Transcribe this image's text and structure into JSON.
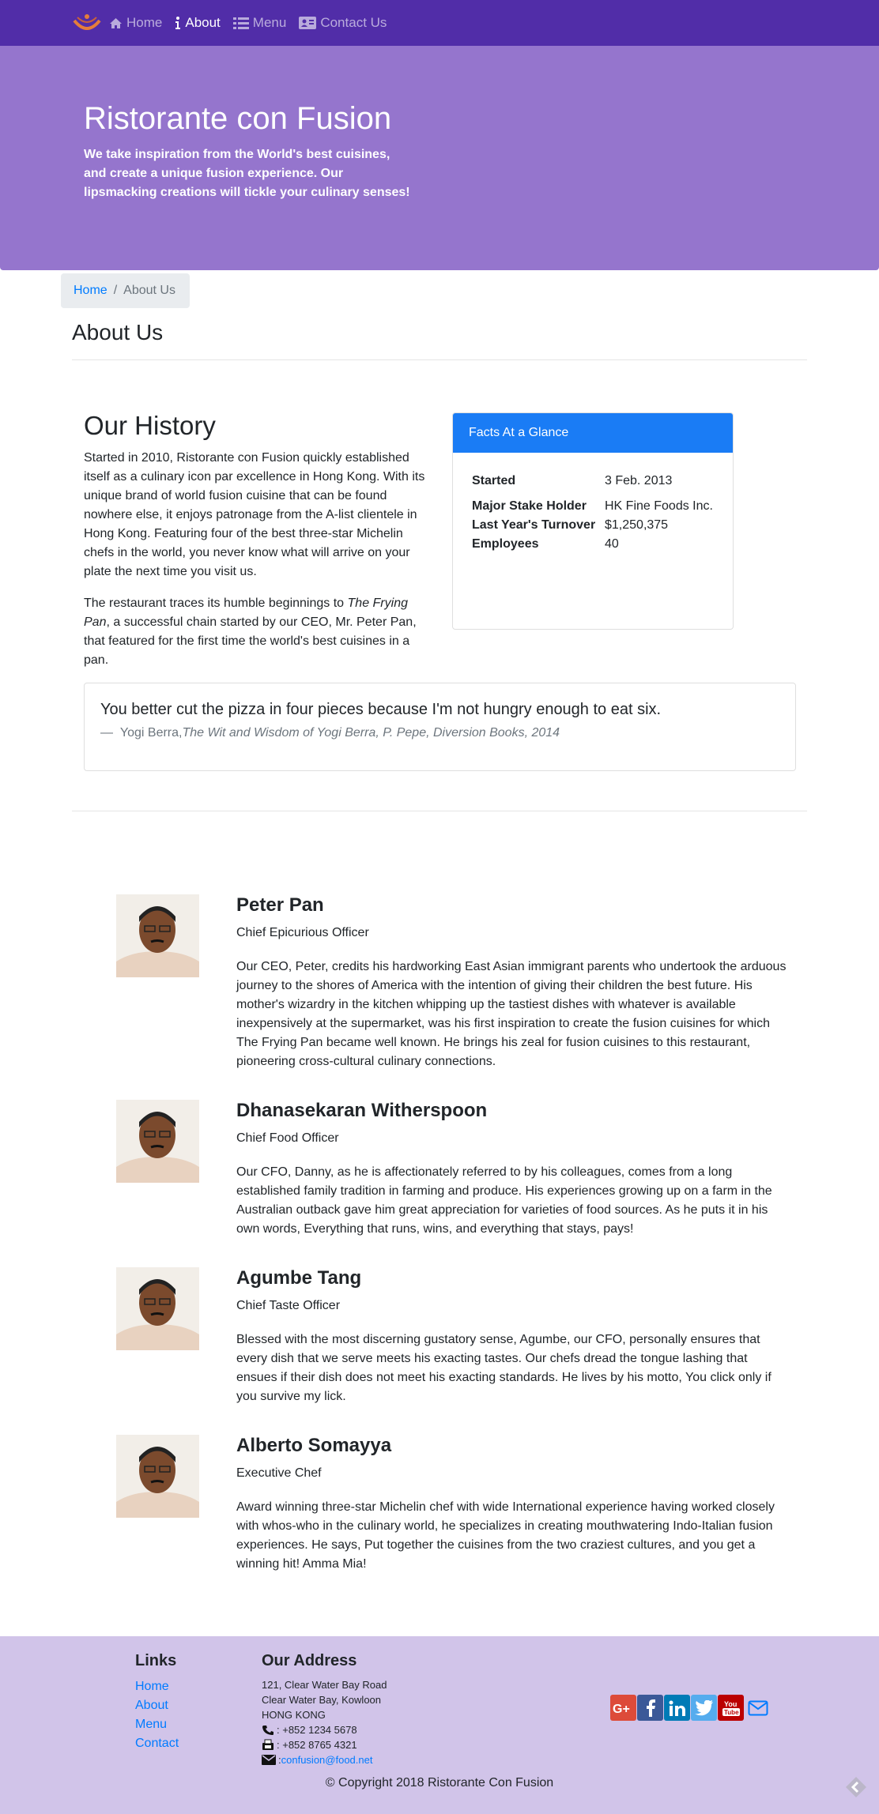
{
  "nav": {
    "items": [
      {
        "label": "Home",
        "icon": "home-icon"
      },
      {
        "label": "About",
        "icon": "info-icon"
      },
      {
        "label": "Menu",
        "icon": "list-icon"
      },
      {
        "label": "Contact Us",
        "icon": "address-card-icon"
      }
    ]
  },
  "jumbotron": {
    "title": "Ristorante con Fusion",
    "text": "We take inspiration from the World's best cuisines, and create a unique fusion experience. Our lipsmacking creations will tickle your culinary senses!"
  },
  "breadcrumb": {
    "home": "Home",
    "separator": "/",
    "current": "About Us"
  },
  "page_title": "About Us",
  "history": {
    "title": "Our History",
    "p1": "Started in 2010, Ristorante con Fusion quickly established itself as a culinary icon par excellence in Hong Kong. With its unique brand of world fusion cuisine that can be found nowhere else, it enjoys patronage from the A-list clientele in Hong Kong. Featuring four of the best three-star Michelin chefs in the world, you never know what will arrive on your plate the next time you visit us.",
    "p2_before": "The restaurant traces its humble beginnings to ",
    "p2_em": "The Frying Pan",
    "p2_after": ", a successful chain started by our CEO, Mr. Peter Pan, that featured for the first time the world's best cuisines in a pan."
  },
  "facts": {
    "header": "Facts At a Glance",
    "rows": [
      {
        "key": "Started",
        "value": "3 Feb. 2013"
      },
      {
        "key": "Major Stake Holder",
        "value": "HK Fine Foods Inc."
      },
      {
        "key": "Last Year's Turnover",
        "value": "$1,250,375"
      },
      {
        "key": "Employees",
        "value": "40"
      }
    ]
  },
  "quote": {
    "text": "You better cut the pizza in four pieces because I'm not hungry enough to eat six.",
    "dash": "—",
    "author": "Yogi Berra,",
    "source": "The Wit and Wisdom of Yogi Berra, P. Pepe, Diversion Books, 2014"
  },
  "leaders": [
    {
      "name": "Peter Pan",
      "role": "Chief Epicurious Officer",
      "desc": "Our CEO, Peter, credits his hardworking East Asian immigrant parents who undertook the arduous journey to the shores of America with the intention of giving their children the best future. His mother's wizardry in the kitchen whipping up the tastiest dishes with whatever is available inexpensively at the supermarket, was his first inspiration to create the fusion cuisines for which The Frying Pan became well known. He brings his zeal for fusion cuisines to this restaurant, pioneering cross-cultural culinary connections."
    },
    {
      "name": "Dhanasekaran Witherspoon",
      "role": "Chief Food Officer",
      "desc": "Our CFO, Danny, as he is affectionately referred to by his colleagues, comes from a long established family tradition in farming and produce. His experiences growing up on a farm in the Australian outback gave him great appreciation for varieties of food sources. As he puts it in his own words, Everything that runs, wins, and everything that stays, pays!"
    },
    {
      "name": "Agumbe Tang",
      "role": "Chief Taste Officer",
      "desc": "Blessed with the most discerning gustatory sense, Agumbe, our CFO, personally ensures that every dish that we serve meets his exacting tastes. Our chefs dread the tongue lashing that ensues if their dish does not meet his exacting standards. He lives by his motto, You click only if you survive my lick."
    },
    {
      "name": "Alberto Somayya",
      "role": "Executive Chef",
      "desc": "Award winning three-star Michelin chef with wide International experience having worked closely with whos-who in the culinary world, he specializes in creating mouthwatering Indo-Italian fusion experiences. He says, Put together the cuisines from the two craziest cultures, and you get a winning hit! Amma Mia!"
    }
  ],
  "footer": {
    "links_title": "Links",
    "links": [
      "Home",
      "About",
      "Menu",
      "Contact"
    ],
    "address_title": "Our Address",
    "address_lines": [
      "121, Clear Water Bay Road",
      "Clear Water Bay, Kowloon",
      "HONG KONG"
    ],
    "phone": ": +852 1234 5678",
    "fax": ": +852 8765 4321",
    "email_prefix": ": ",
    "email": "confusion@food.net",
    "copyright": "© Copyright 2018 Ristorante Con Fusion"
  },
  "colors": {
    "navbar": "#512da8",
    "jumbotron": "#9575cd",
    "footer": "#d1c4e9",
    "link": "#007bff",
    "card_header": "#1a7cf5"
  }
}
